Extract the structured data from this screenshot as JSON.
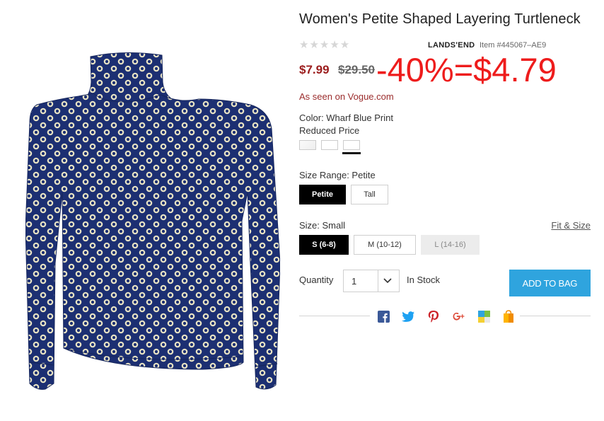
{
  "product": {
    "title": "Women's Petite Shaped Layering Turtleneck",
    "stars": "★★★★★",
    "brand": "LANDS'END",
    "item_number": "Item #445067–AE9",
    "sale_price": "$7.99",
    "original_price": "$29.50",
    "promo_text": "-40%=$4.79",
    "promo_color": "#ee1c1c",
    "sale_color": "#9b1c1c",
    "seen_on": "As seen on Vogue.com"
  },
  "color": {
    "label": "Color: Wharf Blue Print",
    "reduced": "Reduced Price",
    "swatch_count": 3,
    "selected_swatch": 3
  },
  "size_range": {
    "label": "Size Range: Petite",
    "options": [
      {
        "label": "Petite",
        "selected": true
      },
      {
        "label": "Tall",
        "selected": false
      }
    ]
  },
  "size": {
    "label": "Size: Small",
    "fit_link": "Fit & Size",
    "options": [
      {
        "label": "S (6-8)",
        "state": "selected"
      },
      {
        "label": "M (10-12)",
        "state": "available"
      },
      {
        "label": "L (14-16)",
        "state": "unavailable"
      }
    ]
  },
  "quantity": {
    "label": "Quantity",
    "value": "1",
    "stock": "In Stock"
  },
  "cart": {
    "add_label": "ADD TO BAG",
    "accent": "#2fa4de"
  },
  "share": {
    "icons": [
      "facebook-icon",
      "twitter-icon",
      "pinterest-icon",
      "google-plus-icon",
      "flipboard-icon",
      "shopping-bag-icon"
    ]
  }
}
